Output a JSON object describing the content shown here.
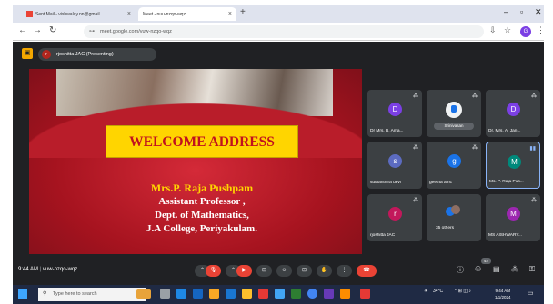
{
  "browser": {
    "tabs": [
      {
        "label": "Sent Mail - vishwalay.nn@gmail",
        "active": false
      },
      {
        "label": "Meet - nuu-nzqo-wqz",
        "active": true
      }
    ],
    "url": "meet.google.com/vuw-nzqo-wqz",
    "profile_initial": "G"
  },
  "presenting": {
    "avatar_initial": "r",
    "label": "rjoshitta JAC (Presenting)"
  },
  "slide": {
    "title": "WELCOME ADDRESS",
    "speaker_name": "Mrs.P. Raja Pushpam",
    "line2": "Assistant Professor ,",
    "line3": "Dept. of Mathematics,",
    "line4": "J.A College, Periyakulam."
  },
  "participants": [
    {
      "name": "Dr Mrs. B. Ama...",
      "initial": "D",
      "color": "#7b3fe4"
    },
    {
      "name": "Srinivasan",
      "initial": "",
      "color": "#1a73e8"
    },
    {
      "name": "Dr. Mrs. A. Jan...",
      "initial": "D",
      "color": "#7b3fe4"
    },
    {
      "name": "suthanthira devi",
      "initial": "s",
      "color": "#5c6bc0"
    },
    {
      "name": "geetha amc",
      "initial": "g",
      "color": "#1a73e8"
    },
    {
      "name": "Ms. P. Raja Pus...",
      "initial": "M",
      "color": "#00897b"
    },
    {
      "name": "rjoshitta JAC",
      "initial": "r",
      "color": "#c2185b"
    },
    {
      "name": "35 others",
      "initial": "",
      "color": "#1a73e8"
    },
    {
      "name": "MS AISHWARY...",
      "initial": "M",
      "color": "#9c27b0"
    }
  ],
  "meeting": {
    "time": "9:44 AM",
    "code": "vuw-nzqo-wqz",
    "people_count": "44"
  },
  "taskbar": {
    "search_placeholder": "Type here to search",
    "weather": "34°C",
    "time": "9:44 AM",
    "date": "1/1/2024"
  }
}
